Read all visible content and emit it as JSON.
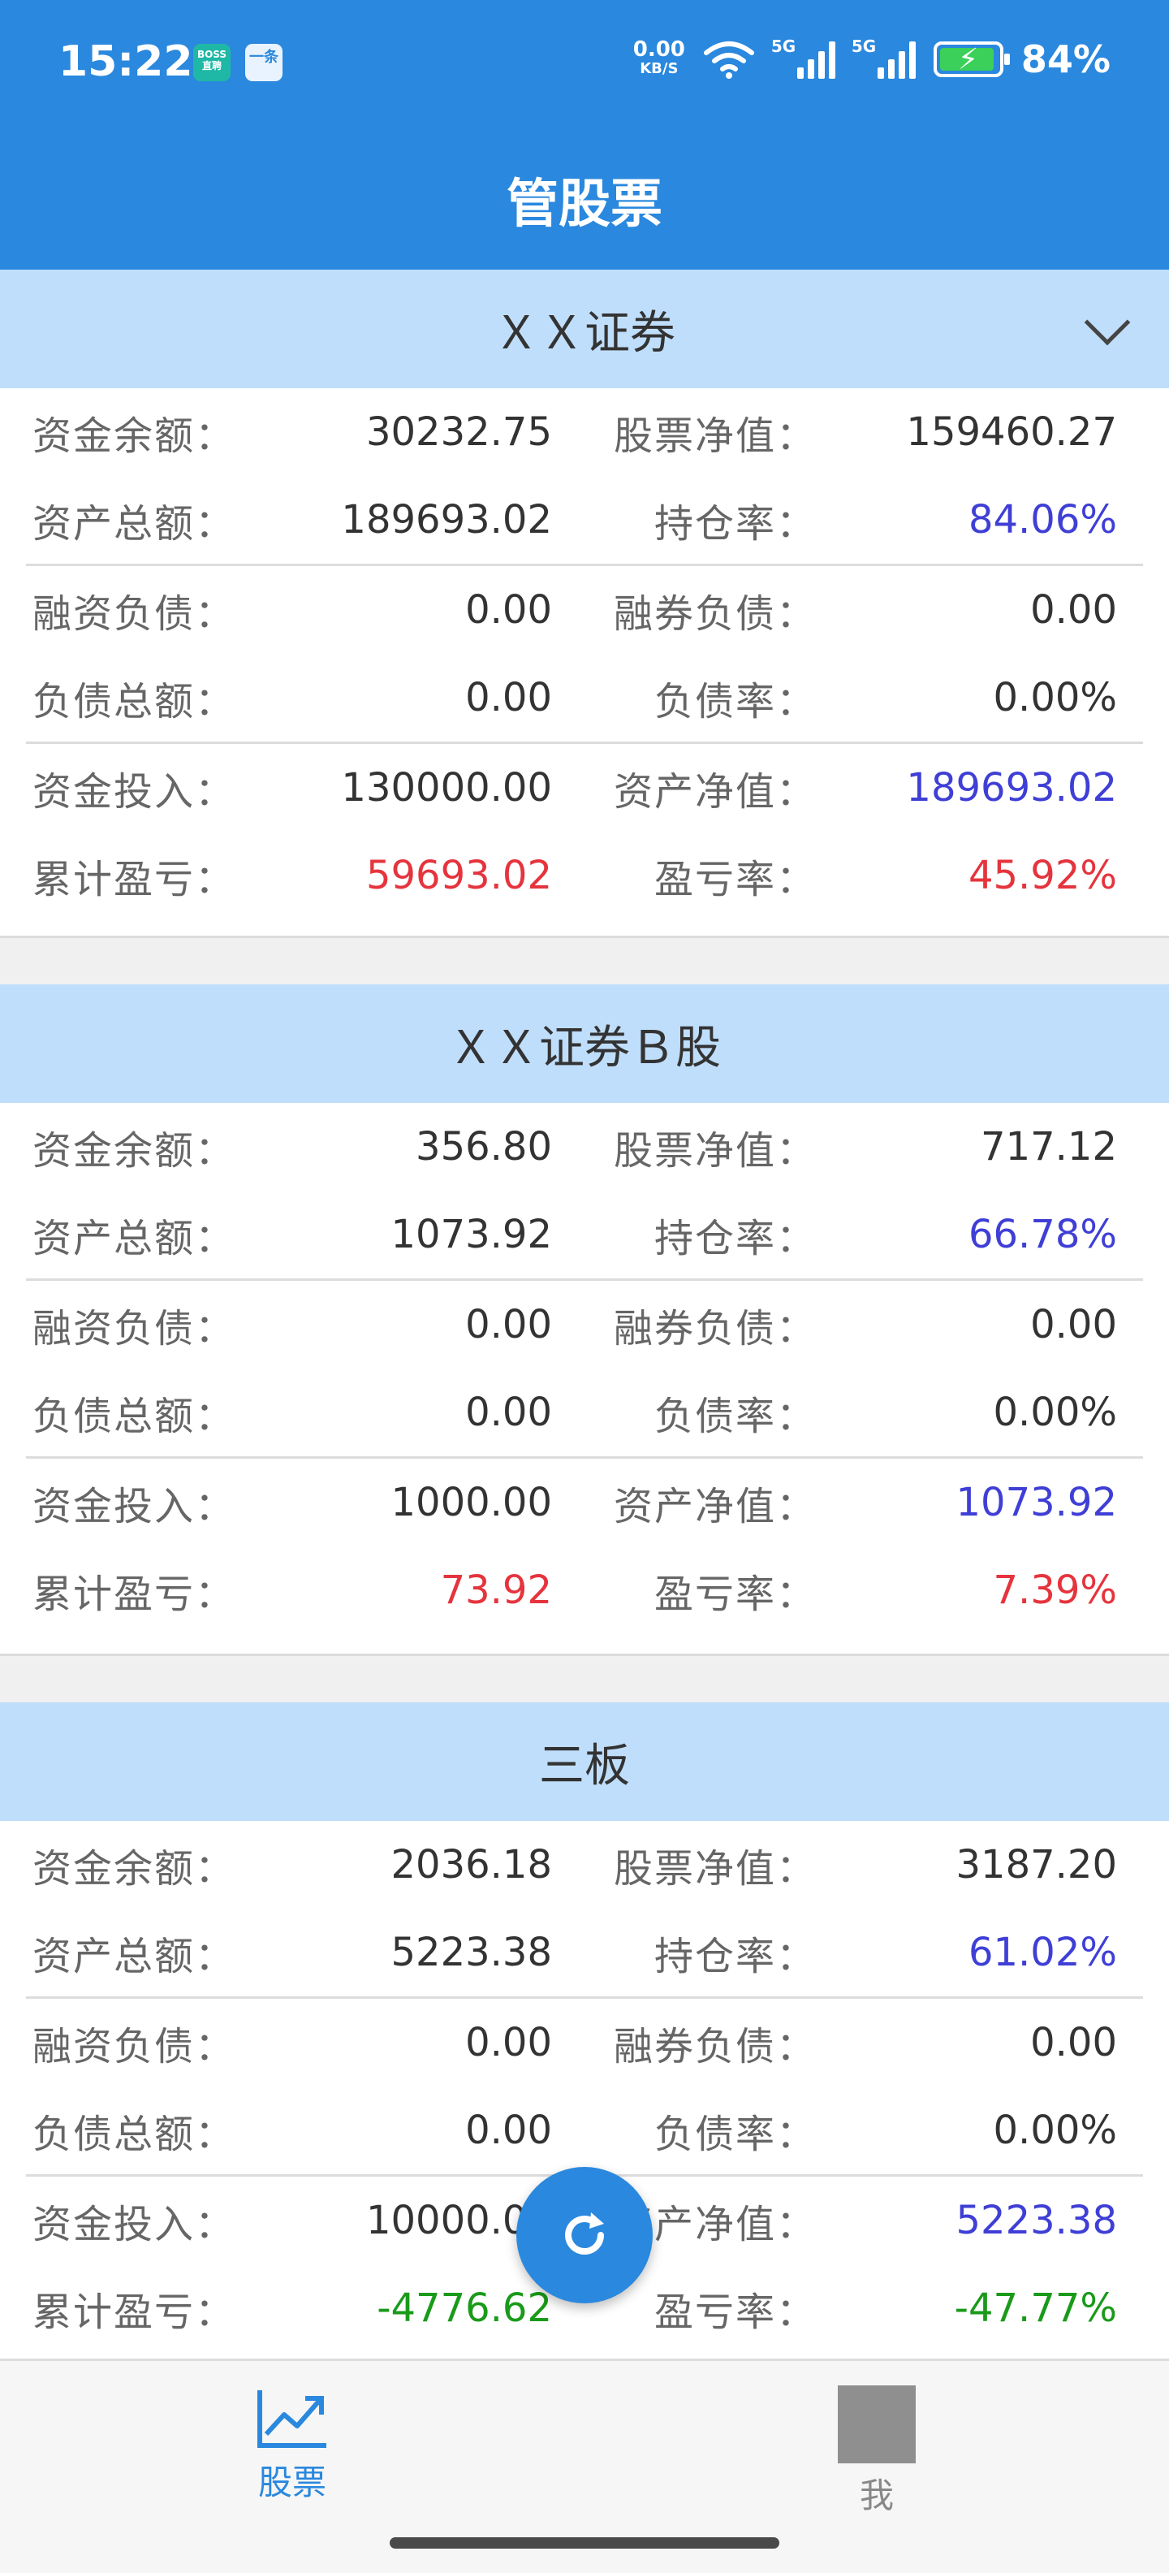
{
  "status": {
    "time": "15:22",
    "app1": "BOSS\n直聘",
    "app2": "一条",
    "net_speed_value": "0.00",
    "net_speed_unit": "KB/S",
    "sig1": "5G",
    "sig2": "5G",
    "battery": "84%"
  },
  "header": {
    "title": "管股票"
  },
  "sections": [
    {
      "title": "ＸＸ证券",
      "rows": [
        {
          "l1": "资金余额：",
          "v1": "30232.75",
          "l2": "股票净值：",
          "v2": "159460.27"
        },
        {
          "l1": "资产总额：",
          "v1": "189693.02",
          "l2": "持仓率：",
          "v2": "84.06%"
        },
        {
          "l1": "融资负债：",
          "v1": "0.00",
          "l2": "融券负债：",
          "v2": "0.00"
        },
        {
          "l1": "负债总额：",
          "v1": "0.00",
          "l2": "负债率：",
          "v2": "0.00%"
        },
        {
          "l1": "资金投入：",
          "v1": "130000.00",
          "l2": "资产净值：",
          "v2": "189693.02"
        },
        {
          "l1": "累计盈亏：",
          "v1": "59693.02",
          "l2": "盈亏率：",
          "v2": "45.92%"
        }
      ]
    },
    {
      "title": "ＸＸ证券Ｂ股",
      "rows": [
        {
          "l1": "资金余额：",
          "v1": "356.80",
          "l2": "股票净值：",
          "v2": "717.12"
        },
        {
          "l1": "资产总额：",
          "v1": "1073.92",
          "l2": "持仓率：",
          "v2": "66.78%"
        },
        {
          "l1": "融资负债：",
          "v1": "0.00",
          "l2": "融券负债：",
          "v2": "0.00"
        },
        {
          "l1": "负债总额：",
          "v1": "0.00",
          "l2": "负债率：",
          "v2": "0.00%"
        },
        {
          "l1": "资金投入：",
          "v1": "1000.00",
          "l2": "资产净值：",
          "v2": "1073.92"
        },
        {
          "l1": "累计盈亏：",
          "v1": "73.92",
          "l2": "盈亏率：",
          "v2": "7.39%"
        }
      ]
    },
    {
      "title": "三板",
      "rows": [
        {
          "l1": "资金余额：",
          "v1": "2036.18",
          "l2": "股票净值：",
          "v2": "3187.20"
        },
        {
          "l1": "资产总额：",
          "v1": "5223.38",
          "l2": "持仓率：",
          "v2": "61.02%"
        },
        {
          "l1": "融资负债：",
          "v1": "0.00",
          "l2": "融券负债：",
          "v2": "0.00"
        },
        {
          "l1": "负债总额：",
          "v1": "0.00",
          "l2": "负债率：",
          "v2": "0.00%"
        },
        {
          "l1": "资金投入：",
          "v1": "10000.00",
          "l2": "资产净值：",
          "v2": "5223.38"
        },
        {
          "l1": "累计盈亏：",
          "v1": "-4776.62",
          "l2": "盈亏率：",
          "v2": "-47.77%"
        }
      ]
    }
  ],
  "nav": {
    "stocks": "股票",
    "me": "我"
  },
  "colors": {
    "primary": "#2a88de",
    "section_bg": "#bfdefb",
    "positive": "#e5343d",
    "negative": "#1a9a1a",
    "highlight": "#3f3fd6"
  }
}
